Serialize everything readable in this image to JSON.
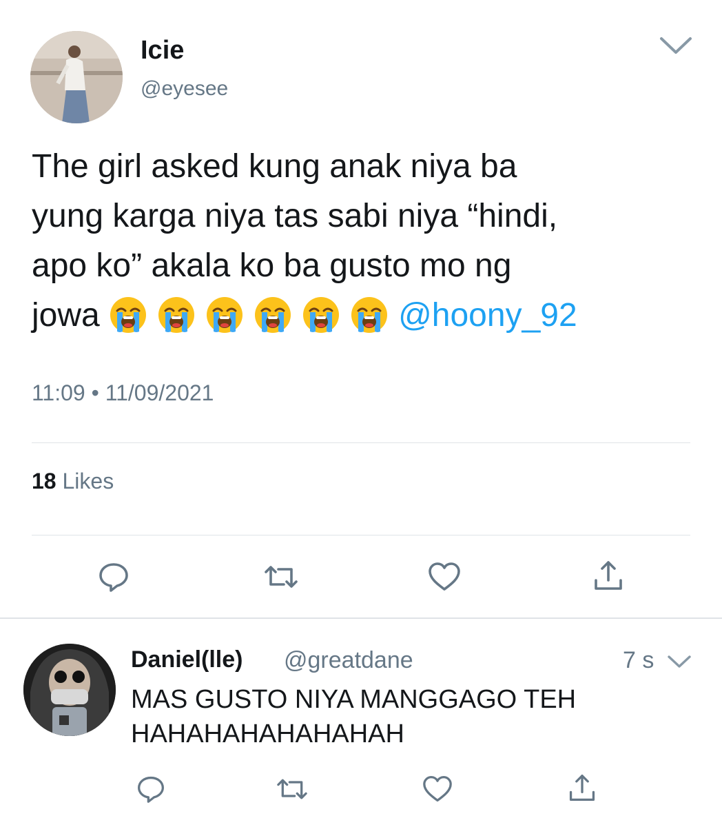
{
  "tweet": {
    "display_name": "Icie",
    "handle": "@eyesee",
    "text_lines": [
      "The girl asked kung anak niya ba",
      "yung karga niya tas sabi niya “hindi,",
      "apo ko” akala ko ba gusto mo ng",
      "jowa"
    ],
    "emoji": "loudly-crying-face",
    "emoji_count": 6,
    "mention": "@hoony_92",
    "timestamp": "11:09 • 11/09/2021",
    "likes_count": "18",
    "likes_label": " Likes",
    "actions": [
      "reply-icon",
      "retweet-icon",
      "like-icon",
      "share-icon"
    ]
  },
  "reply": {
    "display_name": "Daniel(lle)",
    "handle": "@greatdane",
    "time": "7 s",
    "text_lines": [
      "MAS GUSTO NIYA MANGGAGO TEH",
      "HAHAHAHAHAHAHAH"
    ],
    "actions": [
      "reply-icon",
      "retweet-icon",
      "like-icon",
      "share-icon"
    ]
  },
  "colors": {
    "text": "#14171a",
    "secondary": "#657786",
    "link": "#1da1f2",
    "divider": "#dfe3e7"
  }
}
